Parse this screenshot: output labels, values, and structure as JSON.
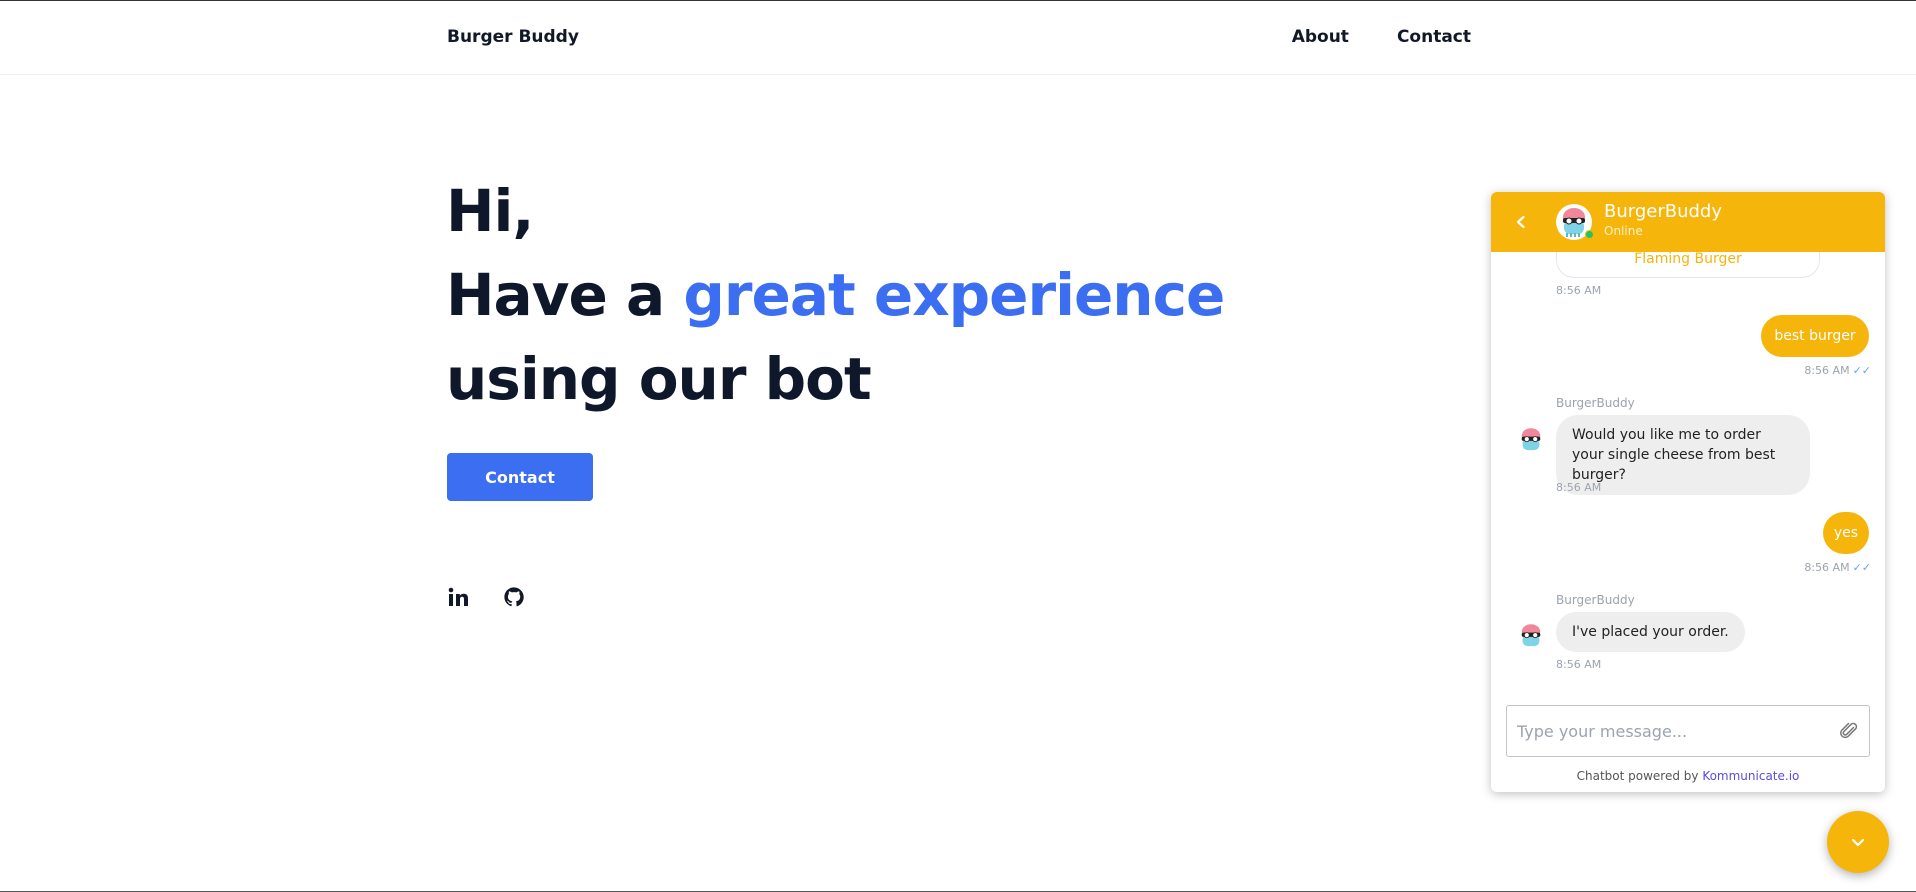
{
  "nav": {
    "brand": "Burger Buddy",
    "links": [
      "About",
      "Contact"
    ]
  },
  "hero": {
    "line1": "Hi,",
    "line2_prefix": "Have a ",
    "line2_accent": "great experience",
    "line3": "using our bot",
    "cta_label": "Contact"
  },
  "socials": [
    {
      "icon": "linkedin-icon"
    },
    {
      "icon": "github-icon"
    }
  ],
  "chat": {
    "bot_name": "BurgerBuddy",
    "status": "Online",
    "quick_reply": "Flaming Burger",
    "messages": [
      {
        "from": "bot",
        "time": "8:56 AM"
      },
      {
        "from": "user",
        "text": "best burger",
        "time": "8:56 AM"
      },
      {
        "from": "bot",
        "sender": "BurgerBuddy",
        "text": "Would you like me to order your single cheese from best burger?",
        "time": "8:56 AM"
      },
      {
        "from": "user",
        "text": "yes",
        "time": "8:56 AM"
      },
      {
        "from": "bot",
        "sender": "BurgerBuddy",
        "text": "I've placed your order.",
        "time": "8:56 AM"
      }
    ],
    "input_placeholder": "Type your message...",
    "powered_prefix": "Chatbot powered by ",
    "powered_link": "Kommunicate.io"
  },
  "colors": {
    "accent_blue": "#3b6ef0",
    "chat_yellow": "#f5b50b",
    "heading": "#0f172a"
  }
}
